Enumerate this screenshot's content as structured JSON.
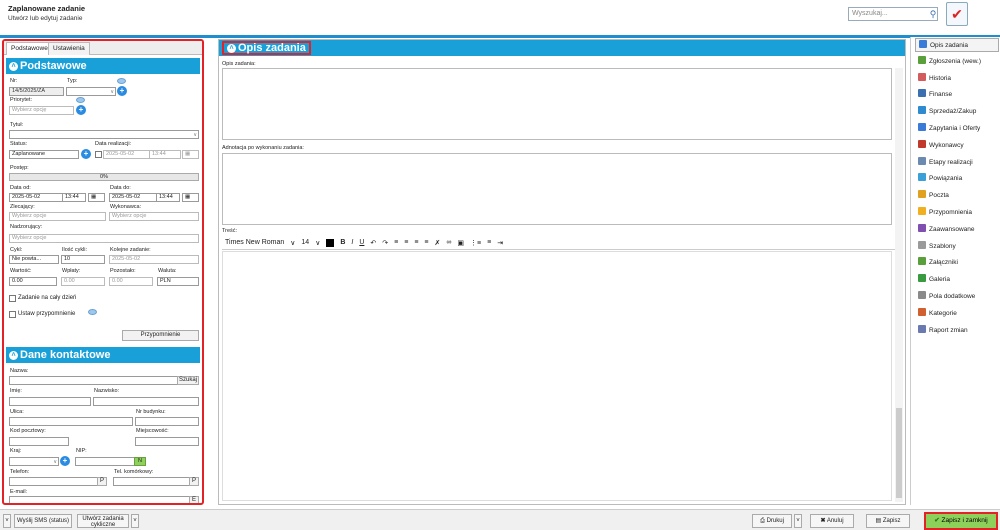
{
  "header": {
    "title": "Zaplanowane zadanie",
    "subtitle": "Utwórz lub edytuj zadanie",
    "search_placeholder": "Wyszukaj..."
  },
  "left": {
    "tabs": [
      "Podstawowe",
      "Ustawienia"
    ],
    "section1": "Podstawowe",
    "nr_label": "Nr:",
    "nr_value": "14/5/2025/ZA",
    "typ_label": "Typ:",
    "priorytet_label": "Priorytet:",
    "priorytet_value": "Wybierz opcję",
    "tytul_label": "Tytuł:",
    "status_label": "Status:",
    "status_value": "Zaplanowane",
    "data_real_label": "Data realizacji:",
    "data_real_date": "2025-05-02",
    "data_real_time": "13:44",
    "postep_label": "Postęp:",
    "postep_value": "0%",
    "progress_fraction": 0,
    "data_od_label": "Data od:",
    "data_od_date": "2025-05-02",
    "data_od_time": "13:44",
    "data_do_label": "Data do:",
    "data_do_date": "2025-05-02",
    "data_do_time": "13:44",
    "zlecajacy_label": "Zlecający:",
    "zlecajacy_value": "Wybierz opcje",
    "wykonawca_label": "Wykonawca:",
    "wykonawca_value": "Wybierz opcje",
    "nadzorujacy_label": "Nadzorujący:",
    "nadzorujacy_value": "Wybierz opcje",
    "cykl_label": "Cykl:",
    "cykl_value": "Nie powta...",
    "ilosc_label": "Ilość cykli:",
    "ilosc_value": "10",
    "kolejne_label": "Kolejne zadanie:",
    "kolejne_value": "2025-05-02",
    "wartosc_label": "Wartość:",
    "wartosc_value": "0.00",
    "wplaty_label": "Wpłaty:",
    "wplaty_value": "0.00",
    "pozostalo_label": "Pozostało:",
    "pozostalo_value": "0.00",
    "waluta_label": "Waluta:",
    "waluta_value": "PLN",
    "caly_dzien": "Zadanie na cały dzień",
    "ustaw_przyp": "Ustaw przypomnienie",
    "przyp_btn": "Przypomnienie",
    "section2": "Dane kontaktowe",
    "nazwa_label": "Nazwa:",
    "szukaj_btn": "Szukaj",
    "imie_label": "Imię:",
    "nazwisko_label": "Nazwisko:",
    "ulica_label": "Ulica:",
    "nr_budynku_label": "Nr budynku:",
    "kod_label": "Kod pocztowy:",
    "miejscowosc_label": "Miejscowość:",
    "kraj_label": "Kraj:",
    "nip_label": "NIP:",
    "nip_btn": "N",
    "telefon_label": "Telefon:",
    "tel_kom_label": "Tel. komórkowy:",
    "p_btn": "P",
    "email_label": "E-mail:",
    "e_btn": "E"
  },
  "main": {
    "title": "Opis zadania",
    "opis_label": "Opis zadania:",
    "adnotacja_label": "Adnotacja po wykonaniu zadania:",
    "tresc_label": "Treść:",
    "font_name": "Times New Roman",
    "font_size": "14"
  },
  "right": {
    "items": [
      {
        "label": "Opis zadania",
        "color": "#3b7bd8"
      },
      {
        "label": "Zgłoszenia (wew.)",
        "color": "#5aa03a"
      },
      {
        "label": "Historia",
        "color": "#d45b5b"
      },
      {
        "label": "Finanse",
        "color": "#3a6fb0"
      },
      {
        "label": "Sprzedaż/Zakup",
        "color": "#2e8bd0"
      },
      {
        "label": "Zapytania i Oferty",
        "color": "#3b7bd8"
      },
      {
        "label": "Wykonawcy",
        "color": "#c0392b"
      },
      {
        "label": "Etapy realizacji",
        "color": "#6a8ab0"
      },
      {
        "label": "Powiązania",
        "color": "#3aa0d8"
      },
      {
        "label": "Poczta",
        "color": "#e0a020"
      },
      {
        "label": "Przypomnienia",
        "color": "#f0b020"
      },
      {
        "label": "Zaawansowane",
        "color": "#8050b0"
      },
      {
        "label": "Szablony",
        "color": "#9a9a9a"
      },
      {
        "label": "Załączniki",
        "color": "#5aa03a"
      },
      {
        "label": "Galeria",
        "color": "#3a9a40"
      },
      {
        "label": "Pola dodatkowe",
        "color": "#8a8a8a"
      },
      {
        "label": "Kategorie",
        "color": "#d06030"
      },
      {
        "label": "Raport zmian",
        "color": "#6a7ab0"
      }
    ]
  },
  "footer": {
    "sms_btn": "Wyślij SMS (status)",
    "cykliczne_btn1": "Utwórz zadania",
    "cykliczne_btn2": "cykliczne",
    "drukuj": "Drukuj",
    "anuluj": "Anuluj",
    "zapisz": "Zapisz",
    "zapisz_zamknij": "Zapisz i zamknij"
  }
}
